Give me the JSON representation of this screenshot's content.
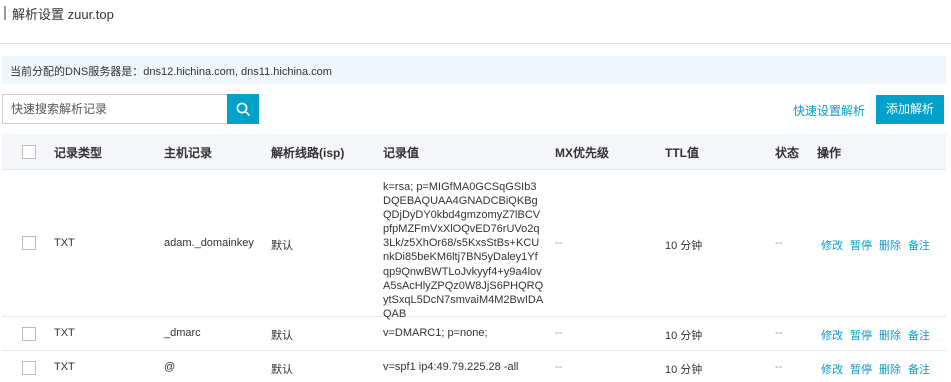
{
  "header": {
    "title": "解析设置 zuur.top"
  },
  "notice": {
    "text": "当前分配的DNS服务器是：dns12.hichina.com, dns11.hichina.com"
  },
  "search": {
    "placeholder": "快速搜索解析记录"
  },
  "actions": {
    "quick_setup": "快速设置解析",
    "add_record": "添加解析"
  },
  "columns": {
    "type": "记录类型",
    "host": "主机记录",
    "line": "解析线路(isp)",
    "value": "记录值",
    "mx": "MX优先级",
    "ttl": "TTL值",
    "status": "状态",
    "ops": "操作"
  },
  "ops_labels": {
    "edit": "修改",
    "pause": "暂停",
    "delete": "删除",
    "note": "备注"
  },
  "rows": [
    {
      "type": "TXT",
      "host": "adam._domainkey",
      "line": "默认",
      "value_lines": [
        "k=rsa; p=MIGfMA0GCSqGSIb3",
        "DQEBAQUAA4GNADCBiQKBg",
        "QDjDyDY0kbd4gmzomyZ7lBCV",
        "pfpMZFmVxXlOQvED76rUVo2q",
        "3Lk/z5XhOr68/s5KxsStBs+KCU",
        "nkDi85beKM6ltj7BN5yDaley1Yf",
        "qp9QnwBWTLoJvkyyf4+y9a4lov",
        "A5sAcHlyZPQz0W8JjS6PHQRQ",
        "ytSxqL5DcN7smvaiM4M2BwIDA",
        "QAB"
      ],
      "mx": "--",
      "ttl": "10 分钟",
      "status": "--"
    },
    {
      "type": "TXT",
      "host": "_dmarc",
      "line": "默认",
      "value": "v=DMARC1; p=none;",
      "mx": "--",
      "ttl": "10 分钟",
      "status": "--"
    },
    {
      "type": "TXT",
      "host": "@",
      "line": "默认",
      "value": "v=spf1 ip4:49.79.225.28 -all",
      "mx": "--",
      "ttl": "10 分钟",
      "status": "--"
    }
  ],
  "colors": {
    "accent": "#00a2ca",
    "link": "#0d9bc5",
    "notice_bg": "#edf7fd",
    "header_bg": "#f5f6fa"
  }
}
